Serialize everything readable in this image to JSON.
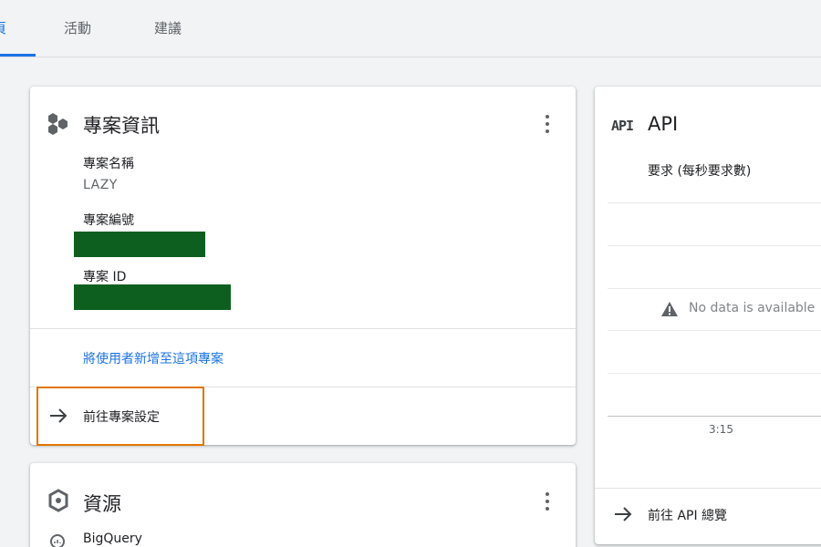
{
  "tabs": [
    {
      "label": "頁"
    },
    {
      "label": "活動"
    },
    {
      "label": "建議"
    }
  ],
  "project_card": {
    "title": "專案資訊",
    "icon": "hexagons-icon",
    "fields": {
      "name_label": "專案名稱",
      "name_value": "LAZY",
      "number_label": "專案編號",
      "id_label": "專案 ID"
    },
    "add_user_link": "將使用者新增至這項專案",
    "settings_action": "前往專案設定"
  },
  "resources_card": {
    "title": "資源",
    "items": [
      {
        "label": "BigQuery"
      }
    ]
  },
  "api_card": {
    "icon_text": "API",
    "title": "API",
    "subtitle": "要求 (每秒要求數)",
    "no_data": "No data is available",
    "x_tick": "3:15",
    "action": "前往 API 總覽"
  },
  "colors": {
    "accent": "#1a73e8",
    "highlight": "#e37400",
    "redaction": "#0d5f1f"
  }
}
